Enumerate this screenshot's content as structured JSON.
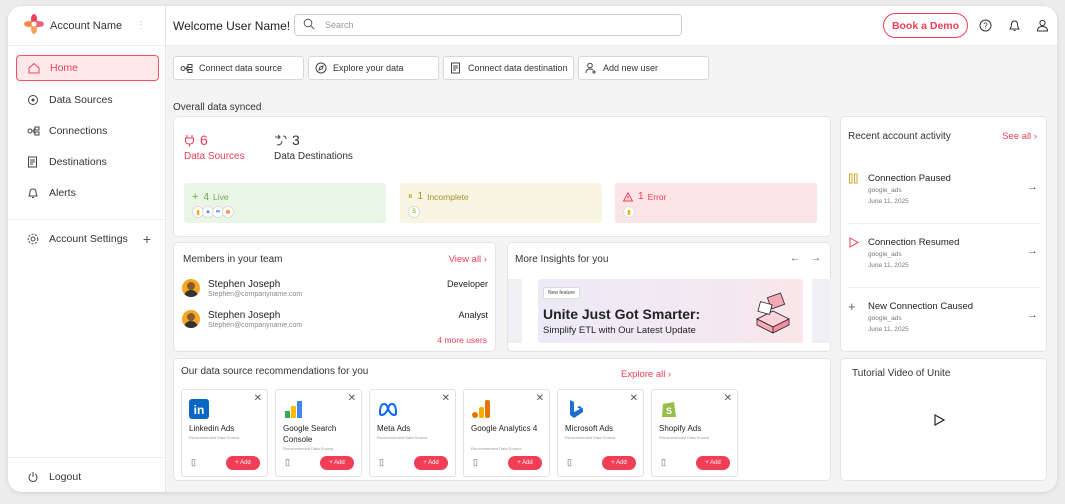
{
  "sidebar": {
    "account_name": "Account Name",
    "items": [
      {
        "label": "Home",
        "icon": "home-icon"
      },
      {
        "label": "Data Sources",
        "icon": "data-sources-icon"
      },
      {
        "label": "Connections",
        "icon": "connections-icon"
      },
      {
        "label": "Destinations",
        "icon": "destinations-icon"
      },
      {
        "label": "Alerts",
        "icon": "bell-icon"
      },
      {
        "label": "Account Settings",
        "icon": "gear-icon"
      }
    ],
    "logout_label": "Logout"
  },
  "header": {
    "welcome": "Welcome User Name!",
    "search_placeholder": "Search",
    "demo_label": "Book a Demo"
  },
  "quick_actions": [
    {
      "label": "Connect data source"
    },
    {
      "label": "Explore your data"
    },
    {
      "label": "Connect data destination"
    },
    {
      "label": "Add new user"
    }
  ],
  "overview": {
    "title": "Overall data synced",
    "sources_count": "6",
    "sources_label": "Data Sources",
    "dest_count": "3",
    "dest_label": "Data Destinations",
    "live_count": "4",
    "live_label": "Live",
    "incomplete_count": "1",
    "incomplete_label": "Incomplete",
    "error_count": "1",
    "error_label": "Error"
  },
  "members": {
    "title": "Members in your team",
    "view_all": "View all",
    "list": [
      {
        "name": "Stephen Joseph",
        "email": "Stephen@companyname.com",
        "role": "Developer"
      },
      {
        "name": "Stephen Joseph",
        "email": "Stephen@companyname.com",
        "role": "Analyst"
      }
    ],
    "more": "4 more users"
  },
  "insights": {
    "title": "More Insights for you",
    "tag": "New feature",
    "headline": "Unite Just Got Smarter:",
    "subline": "Simplify ETL with Our Latest Update"
  },
  "activity": {
    "title": "Recent account activity",
    "see_all": "See all",
    "items": [
      {
        "title": "Connection Paused",
        "source": "google_ads",
        "date": "June 11, 2025"
      },
      {
        "title": "Connection Resumed",
        "source": "google_ads",
        "date": "June 11, 2025"
      },
      {
        "title": "New Connection Caused",
        "source": "google_ads",
        "date": "June 11, 2025"
      }
    ]
  },
  "recommendations": {
    "title": "Our data source recommendations for you",
    "explore": "Explore all",
    "sub_label": "Recommended Data Source",
    "add_label": "+ Add",
    "cards": [
      {
        "name": "Linkedin Ads"
      },
      {
        "name": "Google Search Console"
      },
      {
        "name": "Meta Ads"
      },
      {
        "name": "Google Analytics 4"
      },
      {
        "name": "Microsoft Ads"
      },
      {
        "name": "Shopify Ads"
      }
    ]
  },
  "tutorial": {
    "title": "Tutorial Video of Unite"
  },
  "colors": {
    "accent": "#ef3e55",
    "live_bg": "#e9f5e5",
    "incomplete_bg": "#f8f6e3",
    "error_bg": "#fbe4e5"
  }
}
